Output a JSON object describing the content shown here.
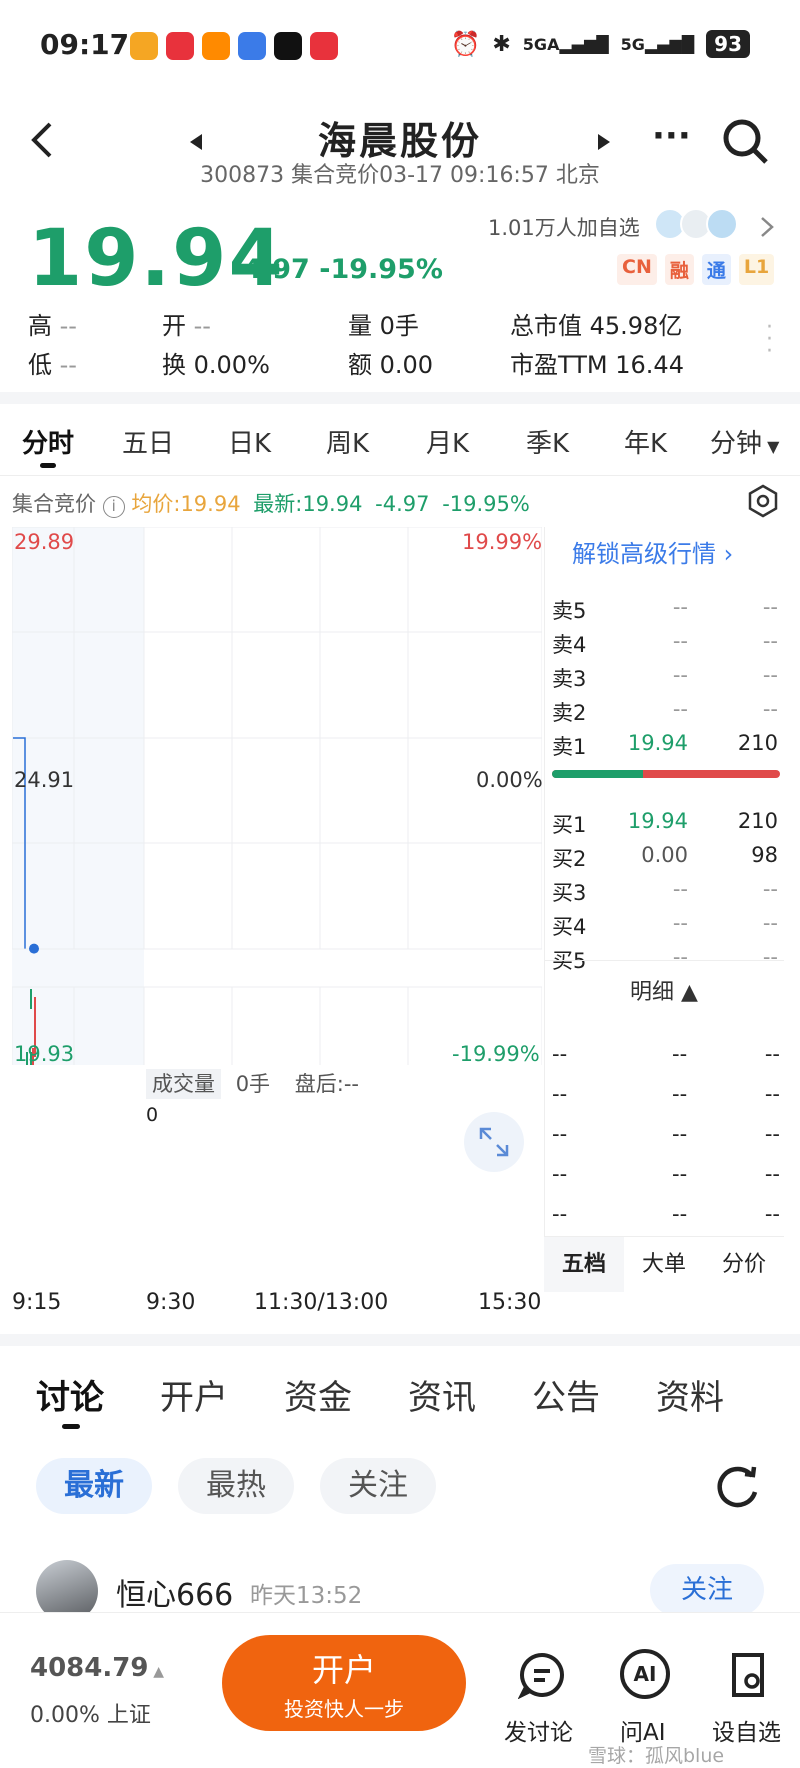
{
  "status_bar": {
    "time": "09:17",
    "signal_1": "5GA",
    "signal_2": "5G",
    "battery": "93",
    "app_icon_colors": [
      "#f5a623",
      "#e8323c",
      "#ff8a00",
      "#3b7be8",
      "#111111",
      "#e8323c"
    ]
  },
  "header": {
    "title": "海晨股份",
    "subtitle": "300873 集合竞价03-17 09:16:57 北京"
  },
  "quote": {
    "price": "19.94",
    "change": "-4.97",
    "change_pct": "-19.95%",
    "watch_count": "1.01万人加自选",
    "badges": [
      {
        "label": "CN",
        "color": "#e8603c",
        "bg": "#fdeee8"
      },
      {
        "label": "融",
        "color": "#e8603c",
        "bg": "#fdeee8"
      },
      {
        "label": "通",
        "color": "#3b7be8",
        "bg": "#e8f0fd"
      },
      {
        "label": "L1",
        "color": "#e8a53c",
        "bg": "#fdf4e3"
      }
    ],
    "high_label": "高",
    "high": "--",
    "low_label": "低",
    "low": "--",
    "open_label": "开",
    "open": "--",
    "turnover_label": "换",
    "turnover": "0.00%",
    "volume_label": "量",
    "volume": "0手",
    "amount_label": "额",
    "amount": "0.00",
    "mcap_label": "总市值",
    "mcap": "45.98亿",
    "pe_label": "市盈TTM",
    "pe": "16.44"
  },
  "period_tabs": [
    "分时",
    "五日",
    "日K",
    "周K",
    "月K",
    "季K",
    "年K",
    "分钟"
  ],
  "auction_bar": {
    "label": "集合竞价",
    "avg": "均价:19.94",
    "latest": "最新:19.94",
    "chg": "-4.97",
    "pct": "-19.95%"
  },
  "chart": {
    "y_top": "29.89",
    "y_mid": "24.91",
    "y_bot": "19.93",
    "pct_top": "19.99%",
    "pct_mid": "0.00%",
    "pct_bot": "-19.99%",
    "volume_label": "成交量",
    "volume_value": "0手",
    "after_hours": "盘后:--",
    "volume_axis_value": "0",
    "time_labels": [
      "9:15",
      "9:30",
      "11:30/13:00",
      "15:30"
    ]
  },
  "chart_data": {
    "type": "line",
    "title": "",
    "xlabel": "",
    "ylabel": "",
    "ylim": [
      19.93,
      29.89
    ],
    "x": [
      "9:15",
      "9:16"
    ],
    "series": [
      {
        "values": [
          24.91,
          19.94
        ]
      }
    ],
    "grid": true
  },
  "order_book": {
    "unlock": "解锁高级行情 ",
    "asks": [
      {
        "label": "卖5",
        "price": "--",
        "vol": "--"
      },
      {
        "label": "卖4",
        "price": "--",
        "vol": "--"
      },
      {
        "label": "卖3",
        "price": "--",
        "vol": "--"
      },
      {
        "label": "卖2",
        "price": "--",
        "vol": "--"
      },
      {
        "label": "卖1",
        "price": "19.94",
        "vol": "210"
      }
    ],
    "bids": [
      {
        "label": "买1",
        "price": "19.94",
        "vol": "210"
      },
      {
        "label": "买2",
        "price": "0.00",
        "vol": "98"
      },
      {
        "label": "买3",
        "price": "--",
        "vol": "--"
      },
      {
        "label": "买4",
        "price": "--",
        "vol": "--"
      },
      {
        "label": "买5",
        "price": "--",
        "vol": "--"
      }
    ],
    "buy_ratio": 0.4,
    "detail_label": "明细 ▲",
    "detail_rows": [
      [
        "--",
        "--",
        "--"
      ],
      [
        "--",
        "--",
        "--"
      ],
      [
        "--",
        "--",
        "--"
      ],
      [
        "--",
        "--",
        "--"
      ],
      [
        "--",
        "--",
        "--"
      ]
    ],
    "bottom_tabs": [
      "五档",
      "大单",
      "分价"
    ]
  },
  "content_tabs": [
    "讨论",
    "开户",
    "资金",
    "资讯",
    "公告",
    "资料"
  ],
  "filters": [
    "最新",
    "最热",
    "关注"
  ],
  "post": {
    "user": "恒心666",
    "time": "昨天13:52",
    "follow": "关注"
  },
  "bottom_bar": {
    "index_value": "4084.79",
    "index_change": "0.00% 上证",
    "open_main": "开户",
    "open_sub": "投资快人一步",
    "actions": [
      "发讨论",
      "问AI",
      "设自选"
    ],
    "watermark": "雪球：孤风blue"
  }
}
